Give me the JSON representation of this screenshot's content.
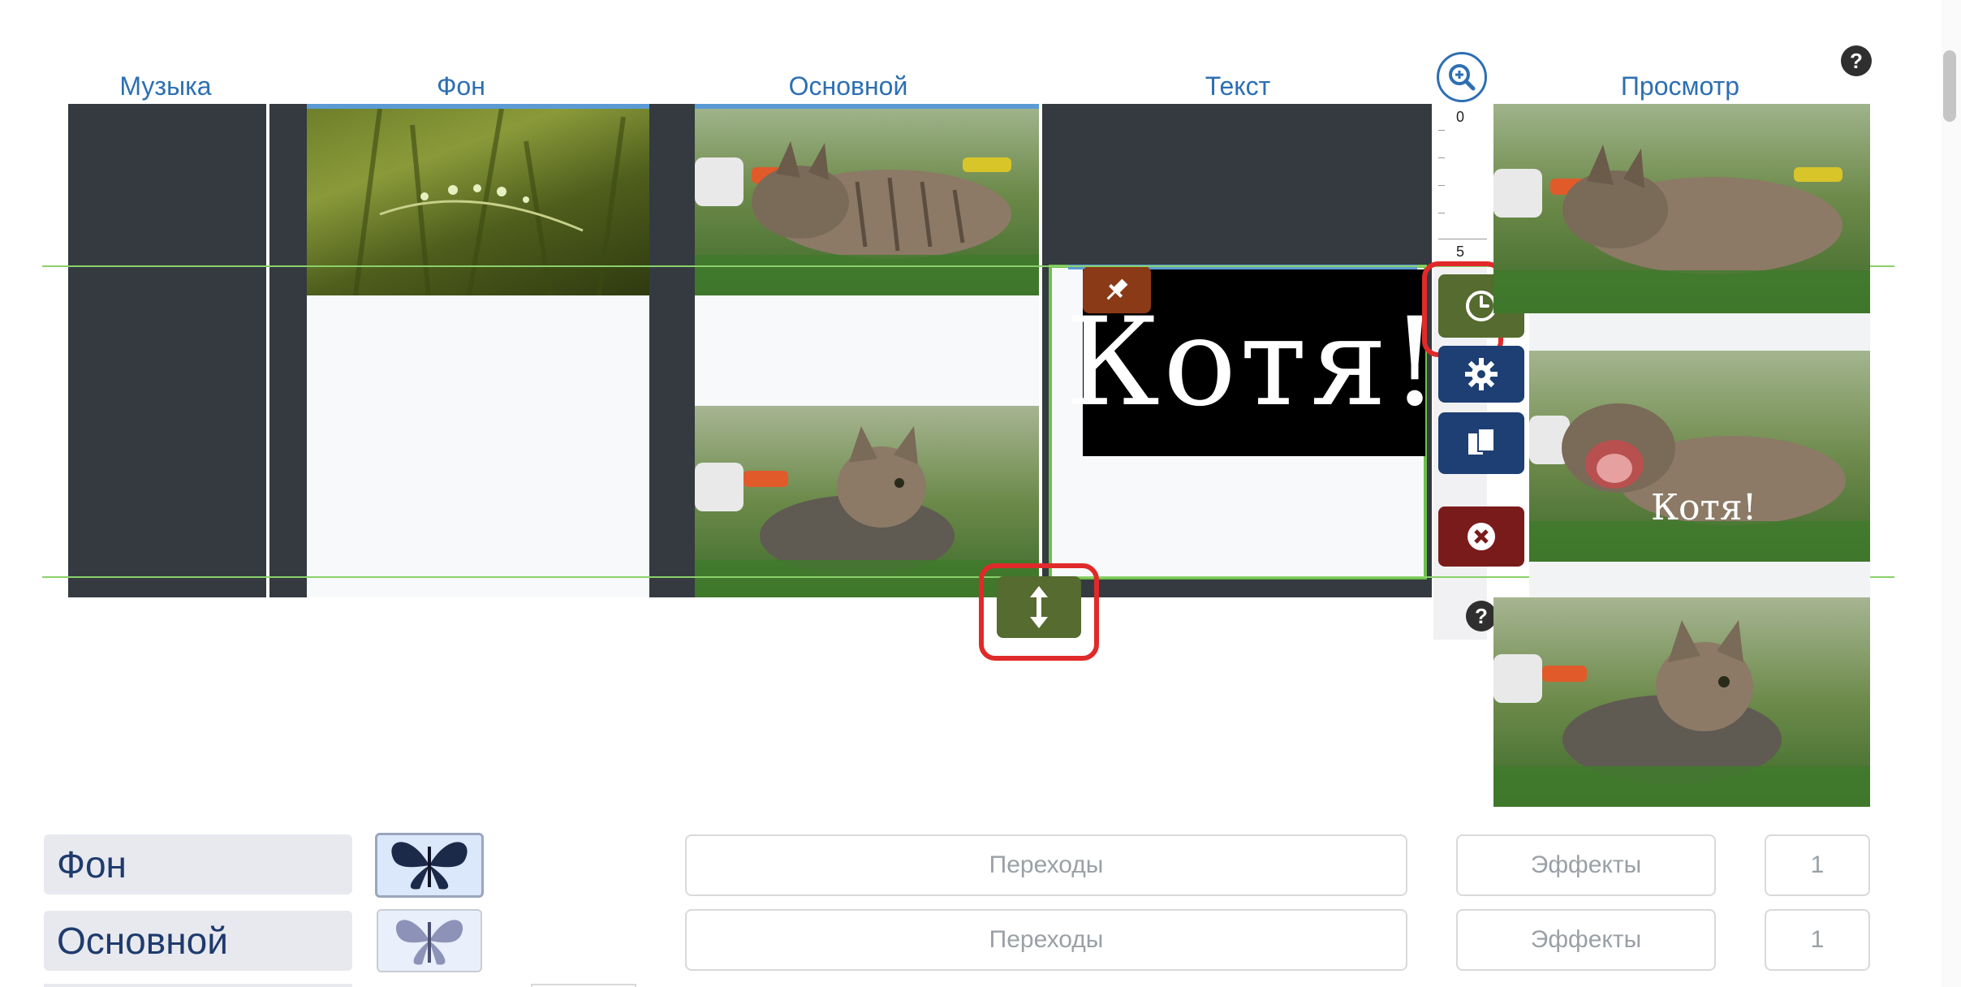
{
  "columns": {
    "music": "Музыка",
    "background": "Фон",
    "main": "Основной",
    "text": "Текст",
    "preview": "Просмотр"
  },
  "ruler": {
    "start": "0",
    "mark": "5"
  },
  "text_clip": {
    "content": "Котя!"
  },
  "preview_caption": "Котя!",
  "help_symbol": "?",
  "settings_rows": [
    {
      "label": "Фон",
      "transitions": "Переходы",
      "effects": "Эффекты",
      "number": "1"
    },
    {
      "label": "Основной",
      "transitions": "Переходы",
      "effects": "Эффекты",
      "number": "1"
    }
  ],
  "colors": {
    "header_blue": "#2d6fb3",
    "dark_column": "#343a40",
    "time_button_green": "#556b2f",
    "settings_blue": "#1d3f73",
    "delete_red": "#7a1b1b",
    "pin_brown": "#8b3a17",
    "highlight_red": "#e02a2a",
    "guide_green": "#8ad16a"
  },
  "icons": {
    "zoom": "zoom-in-icon",
    "time": "clock-icon",
    "settings": "gear-icon",
    "copy": "copy-icon",
    "delete": "close-icon",
    "resize": "resize-vertical-icon",
    "pin": "pin-icon"
  }
}
